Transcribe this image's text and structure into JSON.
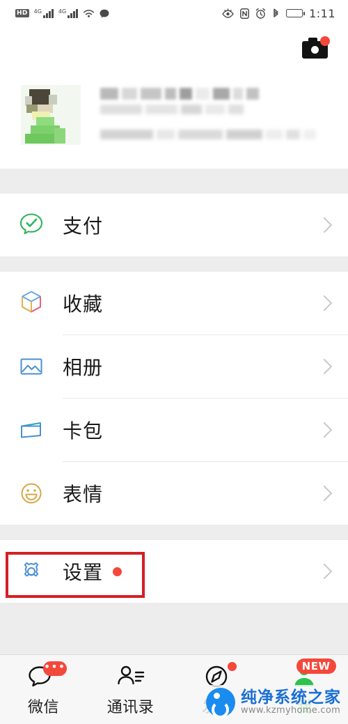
{
  "status_bar": {
    "hd_label": "HD",
    "network_label_1": "4G",
    "network_label_2": "4G",
    "time": "1:11",
    "icons": [
      "hd-badge",
      "signal-bars-1",
      "signal-bars-2",
      "wifi-icon",
      "chat-bubble-icon",
      "eye-comfort-icon",
      "nfc-icon",
      "alarm-clock-icon",
      "bluetooth-icon",
      "battery-icon"
    ]
  },
  "header": {
    "camera_button": "camera-icon",
    "camera_badge": true
  },
  "profile": {
    "name_masked": true,
    "id_masked": true,
    "avatar": "user-avatar"
  },
  "groups": [
    {
      "id": "pay-group",
      "items": [
        {
          "key": "pay",
          "label": "支付",
          "icon": "pay-icon",
          "icon_color": "#2fb35a",
          "badge": false
        }
      ]
    },
    {
      "id": "content-group",
      "items": [
        {
          "key": "favorites",
          "label": "收藏",
          "icon": "cube-icon",
          "icon_color": "#5a9bdc",
          "badge": false
        },
        {
          "key": "album",
          "label": "相册",
          "icon": "photo-icon",
          "icon_color": "#4a8fd0",
          "badge": false
        },
        {
          "key": "cards",
          "label": "卡包",
          "icon": "card-icon",
          "icon_color": "#2aa4bb",
          "badge": false
        },
        {
          "key": "stickers",
          "label": "表情",
          "icon": "smiley-icon",
          "icon_color": "#d6a847",
          "badge": false
        }
      ]
    },
    {
      "id": "settings-group",
      "items": [
        {
          "key": "settings",
          "label": "设置",
          "icon": "gear-icon",
          "icon_color": "#4a90d9",
          "badge": true
        }
      ]
    }
  ],
  "annotation": {
    "target": "settings",
    "color": "#d61f23",
    "shape": "rectangle"
  },
  "tab_bar": {
    "tabs": [
      {
        "key": "wechat",
        "label": "微信",
        "icon": "chat-bubble-icon",
        "badge": "•••",
        "badge_type": "pill",
        "active": false
      },
      {
        "key": "contacts",
        "label": "通讯录",
        "icon": "contacts-icon",
        "badge": "",
        "badge_type": "none",
        "active": false
      },
      {
        "key": "discover",
        "label": "发现",
        "icon": "compass-icon",
        "badge": "",
        "badge_type": "dot",
        "active": false
      },
      {
        "key": "me",
        "label": "我",
        "icon": "person-icon",
        "badge": "NEW",
        "badge_type": "new",
        "active": true
      }
    ],
    "active_color": "#09bb07"
  },
  "watermark": {
    "title": "纯净系统之家",
    "url": "www.kzmyhome.com",
    "logo": "site-logo-icon"
  }
}
